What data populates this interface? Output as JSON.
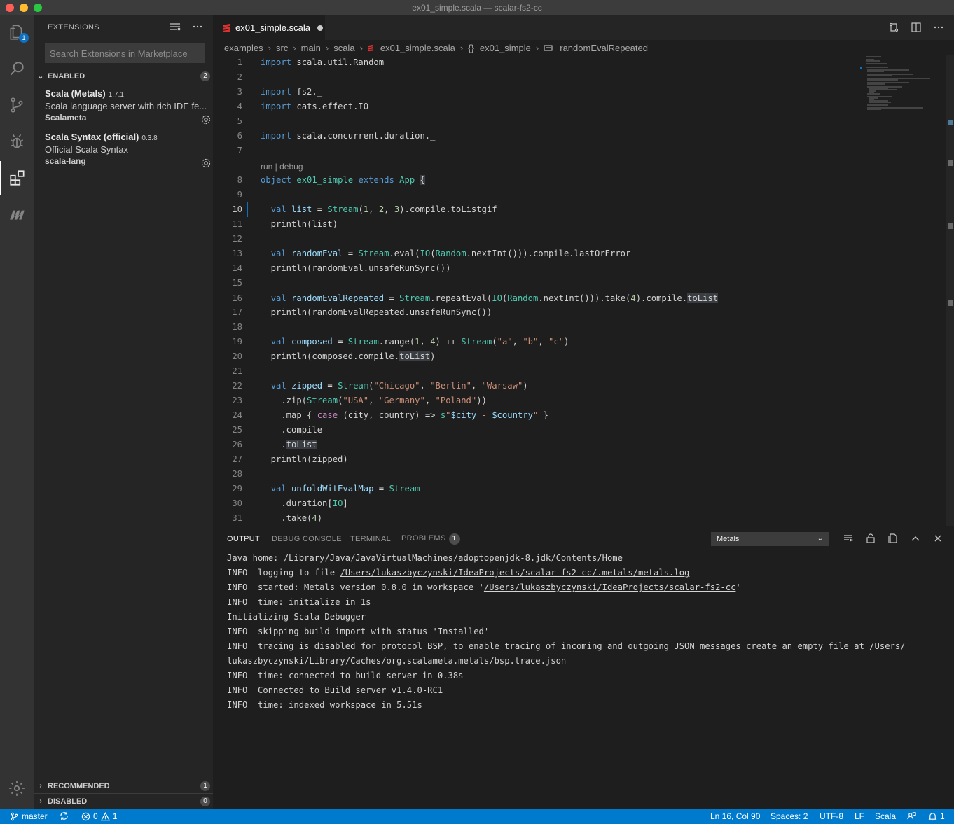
{
  "window": {
    "title": "ex01_simple.scala — scalar-fs2-cc"
  },
  "activity": {
    "explorer_badge": "1"
  },
  "sidebar": {
    "title": "EXTENSIONS",
    "search_placeholder": "Search Extensions in Marketplace",
    "enabled_label": "ENABLED",
    "enabled_count": "2",
    "extensions": [
      {
        "name": "Scala (Metals)",
        "version": "1.7.1",
        "description": "Scala language server with rich IDE fe...",
        "publisher": "Scalameta"
      },
      {
        "name": "Scala Syntax (official)",
        "version": "0.3.8",
        "description": "Official Scala Syntax",
        "publisher": "scala-lang"
      }
    ],
    "recommended_label": "RECOMMENDED",
    "recommended_count": "1",
    "disabled_label": "DISABLED",
    "disabled_count": "0"
  },
  "editor": {
    "tab_label": "ex01_simple.scala",
    "breadcrumb": [
      "examples",
      "src",
      "main",
      "scala",
      "ex01_simple.scala",
      "ex01_simple",
      "randomEvalRepeated"
    ],
    "codelens": "run | debug",
    "line_numbers": [
      "1",
      "2",
      "3",
      "4",
      "5",
      "6",
      "7",
      "8",
      "9",
      "10",
      "11",
      "12",
      "13",
      "14",
      "15",
      "16",
      "17",
      "18",
      "19",
      "20",
      "21",
      "22",
      "23",
      "24",
      "25",
      "26",
      "27",
      "28",
      "29",
      "30",
      "31"
    ]
  },
  "panel": {
    "tabs": {
      "output": "OUTPUT",
      "debug": "DEBUG CONSOLE",
      "terminal": "TERMINAL",
      "problems": "PROBLEMS",
      "problems_count": "1"
    },
    "channel": "Metals",
    "lines": [
      "Java home: /Library/Java/JavaVirtualMachines/adoptopenjdk-8.jdk/Contents/Home",
      "INFO  logging to file ",
      "INFO  started: Metals version 0.8.0 in workspace '",
      "INFO  time: initialize in 1s",
      "Initializing Scala Debugger",
      "INFO  skipping build import with status 'Installed'",
      "INFO  tracing is disabled for protocol BSP, to enable tracing of incoming and outgoing JSON messages create an empty file at /Users/",
      "lukaszbyczynski/Library/Caches/org.scalameta.metals/bsp.trace.json",
      "INFO  time: connected to build server in 0.38s",
      "INFO  Connected to Build server v1.4.0-RC1",
      "INFO  time: indexed workspace in 5.51s"
    ],
    "log_link": "/Users/lukaszbyczynski/IdeaProjects/scalar-fs2-cc/.metals/metals.log",
    "workspace_link": "/Users/lukaszbyczynski/IdeaProjects/scalar-fs2-cc",
    "workspace_end": "'"
  },
  "status": {
    "branch": "master",
    "errors": "0",
    "warnings": "1",
    "position": "Ln 16, Col 90",
    "spaces": "Spaces: 2",
    "encoding": "UTF-8",
    "eol": "LF",
    "language": "Scala",
    "notifications": "1"
  },
  "colors": {
    "accent": "#007acc",
    "keyword": "#569cd6",
    "type": "#4ec9b0",
    "string": "#ce9178",
    "number": "#b5cea8",
    "variable": "#9cdcfe"
  }
}
